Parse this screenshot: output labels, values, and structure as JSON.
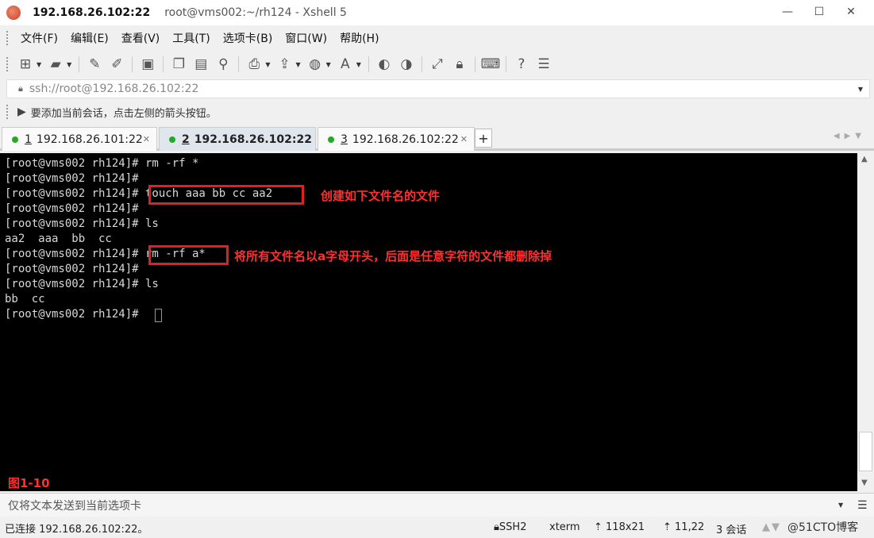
{
  "window": {
    "title_host": "192.168.26.102:22",
    "title_rest": "root@vms002:~/rh124 - Xshell 5",
    "minimize": "—",
    "maximize": "☐",
    "close": "✕"
  },
  "menu": [
    "文件(F)",
    "编辑(E)",
    "查看(V)",
    "工具(T)",
    "选项卡(B)",
    "窗口(W)",
    "帮助(H)"
  ],
  "toolbar_icons": [
    "new-session",
    "open-folder",
    "disconnect",
    "reconnect",
    "properties",
    "copy",
    "paste",
    "find",
    "print",
    "transfer",
    "globe",
    "font",
    "xftp",
    "xmanager",
    "fullscreen",
    "lock",
    "keyboard",
    "help",
    "chat"
  ],
  "address": {
    "text": "ssh://root@192.168.26.102:22"
  },
  "hint": {
    "text": "要添加当前会话，点击左侧的箭头按钮。"
  },
  "tabs": [
    {
      "num": "1",
      "label": "192.168.26.101:22",
      "active": false
    },
    {
      "num": "2",
      "label": "192.168.26.102:22",
      "active": true
    },
    {
      "num": "3",
      "label": "192.168.26.102:22",
      "active": false
    }
  ],
  "tab_add": "+",
  "terminal": {
    "lines": [
      "[root@vms002 rh124]# rm -rf *",
      "[root@vms002 rh124]#",
      "[root@vms002 rh124]# touch aaa bb cc aa2",
      "[root@vms002 rh124]#",
      "[root@vms002 rh124]# ls",
      "aa2  aaa  bb  cc",
      "[root@vms002 rh124]# rm -rf a*",
      "[root@vms002 rh124]#",
      "[root@vms002 rh124]# ls",
      "bb  cc",
      "[root@vms002 rh124]# "
    ],
    "annotation_1": "创建如下文件名的文件",
    "annotation_2": "将所有文件名以a字母开头，后面是任意字符的文件都删除掉",
    "figure_label": "图1-10",
    "highlight_color": "#e02020"
  },
  "sendbar": {
    "text": "仅将文本发送到当前选项卡"
  },
  "status": {
    "connected": "已连接 192.168.26.102:22。",
    "protocol": "SSH2",
    "term": "xterm",
    "size": "118x21",
    "position": "11,22",
    "sessions": "3 会话",
    "watermark": "@51CTO博客"
  }
}
